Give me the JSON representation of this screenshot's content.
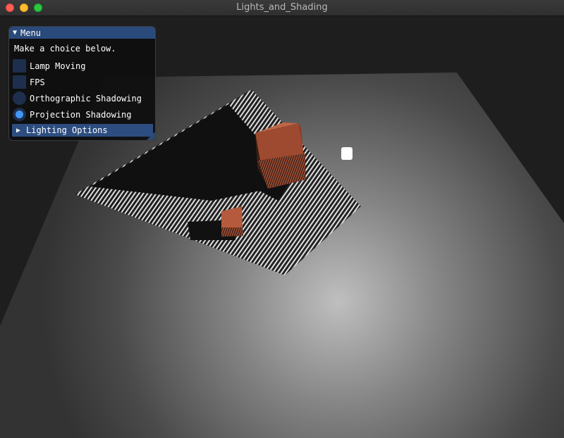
{
  "window": {
    "title": "Lights_and_Shading"
  },
  "menu": {
    "header": "Menu",
    "prompt": "Make a choice below.",
    "options": [
      {
        "label": "Lamp Moving",
        "kind": "checkbox",
        "checked": false
      },
      {
        "label": "FPS",
        "kind": "checkbox",
        "checked": false
      },
      {
        "label": "Orthographic Shadowing",
        "kind": "radio",
        "checked": false
      },
      {
        "label": "Projection Shadowing",
        "kind": "radio",
        "checked": true
      }
    ],
    "collapsed_section": "Lighting Options"
  },
  "colors": {
    "accent": "#4296fa",
    "header_bg": "#294a7a",
    "widget_bg": "#1d2f4d",
    "cube": "#b8573a"
  }
}
